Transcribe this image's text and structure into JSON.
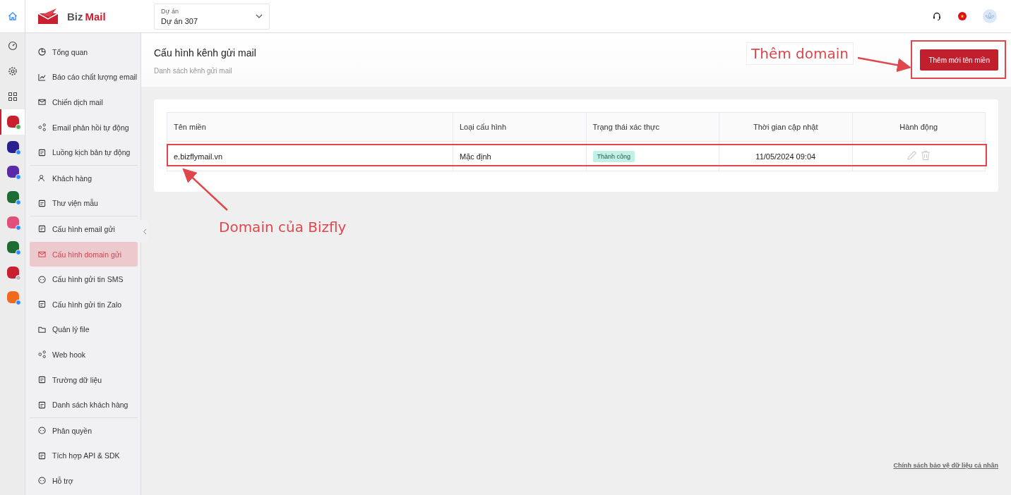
{
  "brand": {
    "name_part_1": "Biz",
    "name_part_2": "Mail"
  },
  "project_select": {
    "label": "Dự án",
    "value": "Dự án 307"
  },
  "rail": {
    "tools": [
      {
        "kind": "gauge"
      },
      {
        "kind": "gear"
      },
      {
        "kind": "grid"
      }
    ],
    "apps": [
      {
        "color": "#c8202f",
        "kind": "online",
        "selected": true
      },
      {
        "color": "#2a1f8f",
        "kind": "available",
        "selected": false
      },
      {
        "color": "#5b2aa8",
        "kind": "available",
        "selected": false
      },
      {
        "color": "#1f6b34",
        "kind": "available",
        "selected": false
      },
      {
        "color": "#e0507a",
        "kind": "available",
        "selected": false
      },
      {
        "color": "#1f6b34",
        "kind": "available",
        "selected": false
      },
      {
        "color": "#c8202f",
        "kind": "inactive",
        "selected": false
      },
      {
        "color": "#f06a1d",
        "kind": "available",
        "selected": false
      }
    ]
  },
  "sidebar": {
    "groups": [
      [
        {
          "label": "Tổng quan",
          "selected": false
        },
        {
          "label": "Báo cáo chất lượng email",
          "selected": false
        },
        {
          "label": "Chiến dịch mail",
          "selected": false
        },
        {
          "label": "Email phản hồi tự động",
          "selected": false
        },
        {
          "label": "Luồng kịch bản tự động",
          "selected": false
        }
      ],
      [
        {
          "label": "Khách hàng",
          "selected": false
        },
        {
          "label": "Thư viện mẫu",
          "selected": false
        }
      ],
      [
        {
          "label": "Cấu hình email gửi",
          "selected": false
        },
        {
          "label": "Cấu hình domain gửi",
          "selected": true
        },
        {
          "label": "Cấu hình gửi tin SMS",
          "selected": false
        },
        {
          "label": "Cấu hình gửi tin Zalo",
          "selected": false
        },
        {
          "label": "Quản lý file",
          "selected": false
        },
        {
          "label": "Web hook",
          "selected": false
        },
        {
          "label": "Trường dữ liệu",
          "selected": false
        },
        {
          "label": "Danh sách khách hàng",
          "selected": false
        }
      ],
      [
        {
          "label": "Phân quyền",
          "selected": false
        },
        {
          "label": "Tích hợp API & SDK",
          "selected": false
        },
        {
          "label": "Hỗ trợ",
          "selected": false
        }
      ]
    ]
  },
  "page": {
    "title": "Cấu hình kênh gửi mail",
    "subtitle": "Danh sách kênh gửi mail",
    "primary_button": "Thêm mới tên miền"
  },
  "table": {
    "columns": [
      "Tên miền",
      "Loại cấu hình",
      "Trạng thái xác thực",
      "Thời gian cập nhật",
      "Hành động"
    ],
    "rows": [
      {
        "domain": "e.bizflymail.vn",
        "config_type": "Mặc định",
        "status": {
          "label": "Thành công",
          "kind": "success"
        },
        "updated": "11/05/2024 09:04"
      }
    ]
  },
  "footer_link": "Chính sách bảo vệ dữ liệu cá nhân",
  "annotations": [
    {
      "text": "Thêm domain"
    },
    {
      "text": "Domain của Bizfly"
    }
  ]
}
